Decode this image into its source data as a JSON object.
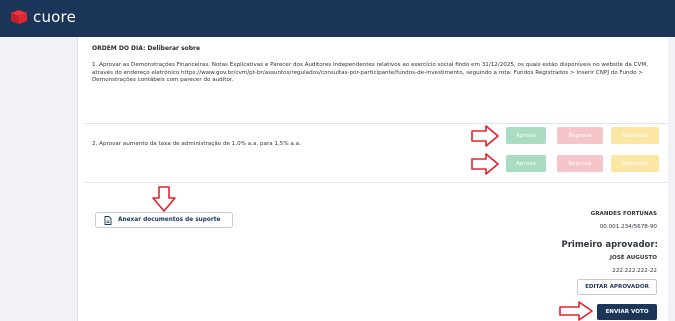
{
  "app": {
    "logo_text": "cuore"
  },
  "agenda": {
    "heading": "ORDEM DO DIA: Deliberar sobre",
    "items": [
      {
        "text": "1. Aprovar as Demonstrações Financeiras, Notas Explicativas e Parecer dos Auditores Independentes relativos ao exercício social findo em 31/12/2025, os quais estão disponíveis no website da CVM, através do endereço eletrônico https://www.gov.br/cvm/pt-br/assuntos/regulados/consultas-por-participante/fundos-de-investimento, seguindo a rota: Fundos Registrados > Inserir CNPJ do Fundo > Demonstrações contábeis com parecer do auditor."
      },
      {
        "text": "2. Aprovar aumento da taxa de administração de 1,0% a.a. para 1,5% a.a."
      }
    ],
    "vote_labels": {
      "aprova": "Aprova",
      "reprova": "Reprova",
      "abstem": "Abstenho"
    }
  },
  "attachments": {
    "button_label": "Anexar documentos de suporte"
  },
  "fund": {
    "name": "GRANDES FORTUNAS",
    "cnpj": "00.001.234/5678-90"
  },
  "approver": {
    "title": "Primeiro aprovador:",
    "name": "JOSÉ AUGUSTO",
    "cpf": "222.222.222-22",
    "edit_label": "EDITAR APROVADOR"
  },
  "actions": {
    "submit_label": "ENVIAR VOTO"
  },
  "colors": {
    "topbar": "#1c365a",
    "aprova": "#a9dcc1",
    "reprova": "#f6c5c9",
    "abstem": "#fbe6a4",
    "annotation_arrow": "#e8202a"
  }
}
